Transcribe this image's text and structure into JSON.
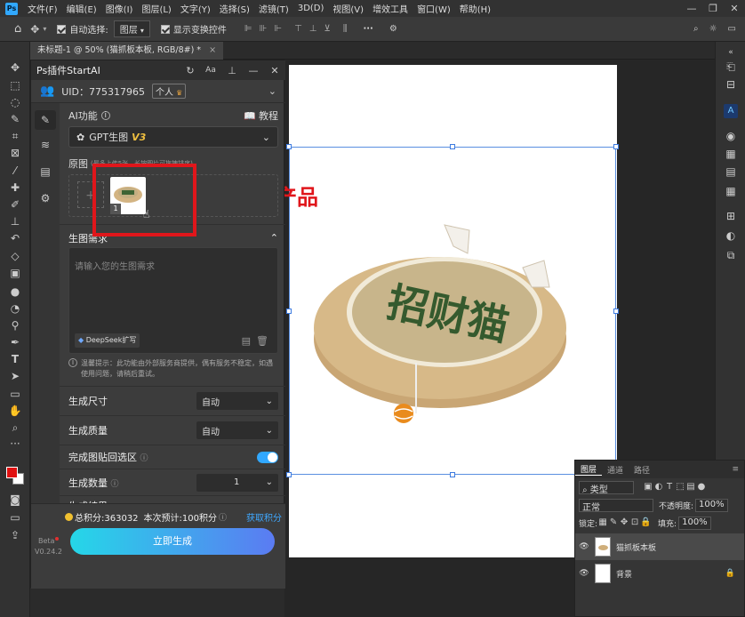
{
  "menu": {
    "items": [
      "文件(F)",
      "编辑(E)",
      "图像(I)",
      "图层(L)",
      "文字(Y)",
      "选择(S)",
      "滤镜(T)",
      "3D(D)",
      "视图(V)",
      "增效工具",
      "窗口(W)",
      "帮助(H)"
    ]
  },
  "options": {
    "auto_select_label": "自动选择:",
    "auto_select_value": "图层",
    "show_transform_label": "显示变换控件",
    "more": "···"
  },
  "document": {
    "tab_title": "未标题-1 @ 50% (猫抓板本板, RGB/8#) *",
    "close": "×"
  },
  "plugin": {
    "title": "Ps插件StartAI",
    "uid": "UID：775317965",
    "account_badge": "个人",
    "ai_function_label": "AI功能",
    "tutorial_label": "教程",
    "model_name": "GPT生图",
    "model_version": "V3",
    "source_label": "原图",
    "source_hint": "(最多上传5张，长按图片可拖拽排序)",
    "thumb_index": "1",
    "prompt_section": "生图需求",
    "prompt_placeholder": "请输入您的生图需求",
    "deepseek_label": "DeepSeek扩写",
    "warning": "温馨提示：此功能由外部服务商提供，偶有服务不稳定，如遇使用问题，请稍后重试。",
    "size_label": "生成尺寸",
    "size_value": "自动",
    "quality_label": "生成质量",
    "quality_value": "自动",
    "paste_label": "完成图贴回选区",
    "count_label": "生成数量",
    "count_value": "1",
    "partial_label": "生成结果",
    "points_total": "总积分:363032",
    "points_estimate": "本次预计:100积分",
    "get_points": "获取积分",
    "generate_button": "立即生成",
    "beta": "Beta",
    "version": "V0.24.2"
  },
  "annotation": {
    "text": "上传产品",
    "color": "#e0161b"
  },
  "product": {
    "title_art": "招财猫"
  },
  "layers_panel": {
    "tabs": [
      "图层",
      "通道",
      "路径"
    ],
    "filter_kind": "类型",
    "blend_mode": "正常",
    "opacity_label": "不透明度:",
    "opacity_value": "100%",
    "lock_label": "锁定:",
    "fill_label": "填充:",
    "fill_value": "100%",
    "layers": [
      {
        "name": "猫抓板本板"
      },
      {
        "name": "背景"
      }
    ]
  },
  "colors": {
    "accent_blue": "#31a8ff",
    "generate_gradient_start": "#25d7e8",
    "generate_gradient_end": "#5b7bf2",
    "points_link": "#3fa8ff"
  }
}
